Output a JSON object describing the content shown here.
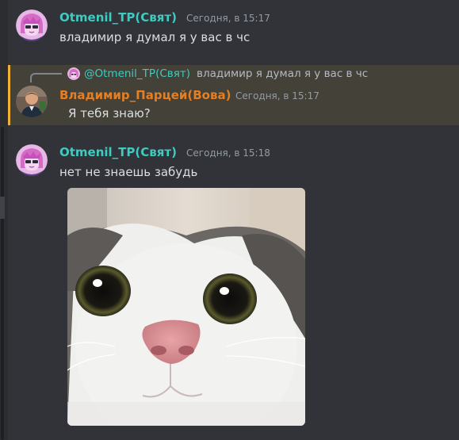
{
  "messages": [
    {
      "author": "Otmenil_TP(Свят)",
      "timestamp": "Сегодня, в 15:17",
      "text": "владимир я думал я у вас в чс"
    },
    {
      "reply": {
        "author": "@Otmenil_TP(Свят)",
        "text": "владимир я думал я у вас в чс"
      },
      "author": "Владимир_Парцей(Вова)",
      "timestamp": "Сегодня, в 15:17",
      "text": "Я тебя знаю?"
    },
    {
      "author": "Otmenil_TP(Свят)",
      "timestamp": "Сегодня, в 15:18",
      "text": "нет не знаешь забудь",
      "attachment": "cat-photo-image"
    }
  ],
  "colors": {
    "background": "#313338",
    "author_teal": "#3ecbc0",
    "author_orange": "#e67e22",
    "mention_highlight": "#444139",
    "mention_bar": "#f0b232"
  }
}
